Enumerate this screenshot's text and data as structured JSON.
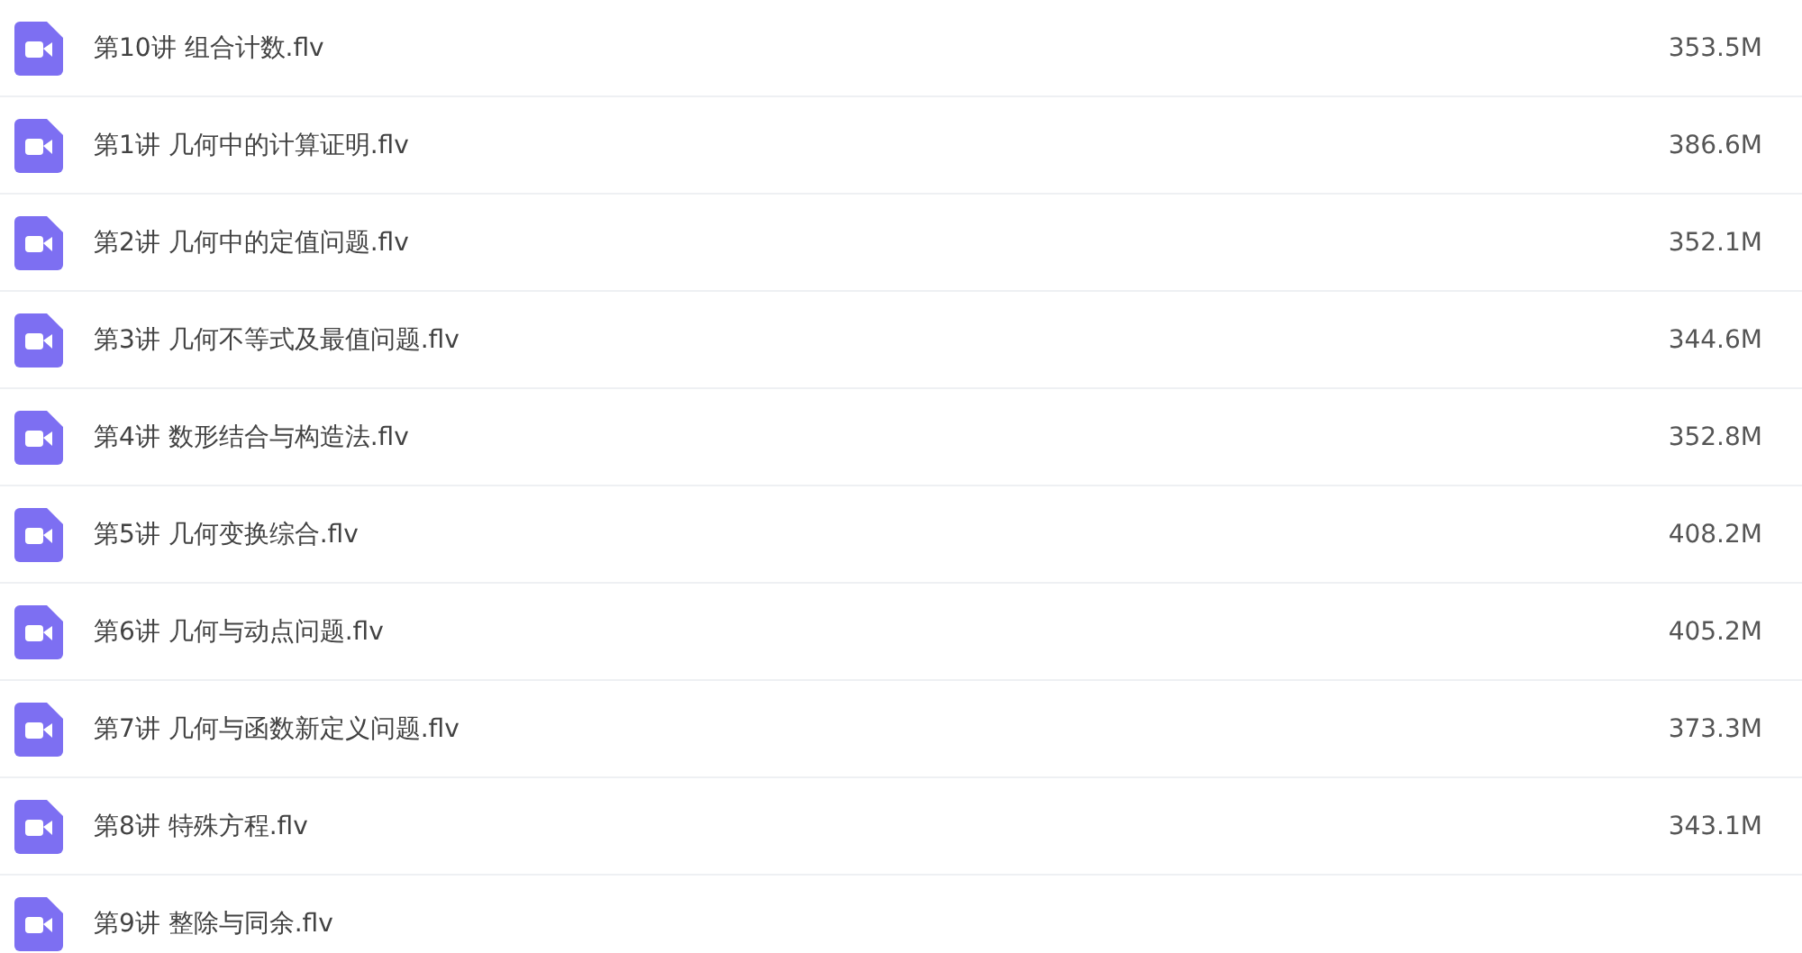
{
  "files": [
    {
      "name": "第10讲 组合计数.flv",
      "size": "353.5M"
    },
    {
      "name": "第1讲 几何中的计算证明.flv",
      "size": "386.6M"
    },
    {
      "name": "第2讲 几何中的定值问题.flv",
      "size": "352.1M"
    },
    {
      "name": "第3讲 几何不等式及最值问题.flv",
      "size": "344.6M"
    },
    {
      "name": "第4讲 数形结合与构造法.flv",
      "size": "352.8M"
    },
    {
      "name": "第5讲 几何变换综合.flv",
      "size": "408.2M"
    },
    {
      "name": "第6讲 几何与动点问题.flv",
      "size": "405.2M"
    },
    {
      "name": "第7讲 几何与函数新定义问题.flv",
      "size": "373.3M"
    },
    {
      "name": "第8讲 特殊方程.flv",
      "size": "343.1M"
    },
    {
      "name": "第9讲 整除与同余.flv"
    }
  ]
}
